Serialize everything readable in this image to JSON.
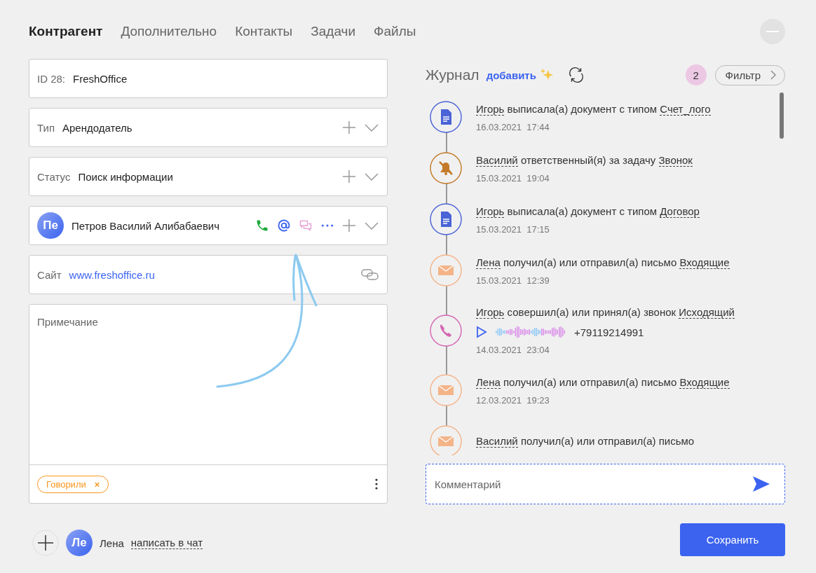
{
  "tabs": [
    {
      "label": "Контрагент",
      "selected": true
    },
    {
      "label": "Дополнительно",
      "selected": false
    },
    {
      "label": "Контакты",
      "selected": false
    },
    {
      "label": "Задачи",
      "selected": false
    },
    {
      "label": "Файлы",
      "selected": false
    }
  ],
  "fields": [
    {
      "kind": "text",
      "label": "ID 28:",
      "value": "FreshOffice"
    },
    {
      "kind": "select",
      "label": "Тип",
      "value": "Арендодатель"
    },
    {
      "kind": "select",
      "label": "Статус",
      "value": "Поиск информации"
    },
    {
      "kind": "contact",
      "initials": "Пе",
      "value": "Петров Василий Алибабаевич"
    },
    {
      "kind": "link",
      "label": "Сайт",
      "value": "www.freshoffice.ru"
    }
  ],
  "note": {
    "placeholder": "Примечание",
    "tags": [
      {
        "label": "Говорили",
        "remove": "×"
      }
    ]
  },
  "footer": {
    "initials": "Ле",
    "name": "Лена",
    "link": "написать в чат"
  },
  "journal": {
    "title": "Журнал",
    "add": "добавить",
    "badge": "2",
    "filter": "Фильтр",
    "entries": [
      {
        "kind": "document",
        "color": "#4a63d6",
        "author": "Игорь",
        "action": "выписала(а) документ с типом",
        "object": "Счет_лого",
        "date": "16.03.2021",
        "time": "17:44"
      },
      {
        "kind": "task",
        "color": "#c47a2a",
        "author": "Василий",
        "action": "ответственный(я) за задачу",
        "object": "Звонок",
        "date": "15.03.2021",
        "time": "19:04"
      },
      {
        "kind": "document",
        "color": "#4a63d6",
        "author": "Игорь",
        "action": "выписала(а) документ с типом",
        "object": "Договор",
        "date": "15.03.2021",
        "time": "17:15"
      },
      {
        "kind": "mail",
        "color": "#f4b488",
        "author": "Лена",
        "action": "получил(а) или отправил(а) письмо",
        "object": "Входящие",
        "date": "15.03.2021",
        "time": "12:39"
      },
      {
        "kind": "call",
        "color": "#d665b4",
        "author": "Игорь",
        "action": "совершил(а) или принял(а) звонок",
        "object": "Исходящий",
        "phone": "+79119214991",
        "date": "14.03.2021",
        "time": "23:04"
      },
      {
        "kind": "mail",
        "color": "#f4b488",
        "author": "Лена",
        "action": "получил(а) или отправил(а) письмо",
        "object": "Входящие",
        "date": "12.03.2021",
        "time": "19:23"
      },
      {
        "kind": "mail",
        "color": "#f4b488",
        "author": "Василий",
        "action": "получил(а) или отправил(а) письмо"
      }
    ]
  },
  "comment": {
    "placeholder": "Комментарий"
  },
  "save_button": "Сохранить"
}
